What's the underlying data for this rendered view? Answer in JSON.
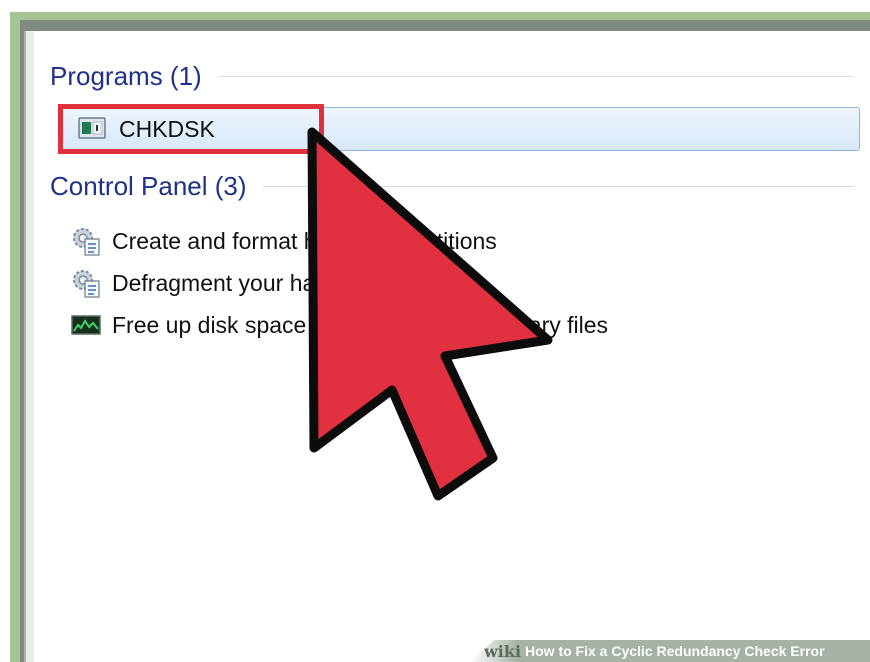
{
  "sections": {
    "programs": {
      "title": "Programs (1)",
      "items": [
        {
          "label": "CHKDSK",
          "icon": "chkdsk-app-icon"
        }
      ]
    },
    "control_panel": {
      "title": "Control Panel (3)",
      "items": [
        {
          "label": "Create and format hard disk partitions",
          "icon": "control-panel-settings-icon"
        },
        {
          "label": "Defragment your hard drive",
          "icon": "control-panel-settings-icon"
        },
        {
          "label": "Free up disk space by deleting unnecessary files",
          "icon": "disk-cleanup-icon"
        }
      ]
    }
  },
  "watermark": {
    "brand": "wiki",
    "text": "How to Fix a Cyclic Redundancy Check Error"
  },
  "colors": {
    "section_title": "#1e3287",
    "selection_fill": "#d7e8f8",
    "selection_border": "#8fb6df",
    "highlight_red": "#e0303c",
    "cursor_red": "#e13040",
    "frame_green": "#a5c393"
  }
}
